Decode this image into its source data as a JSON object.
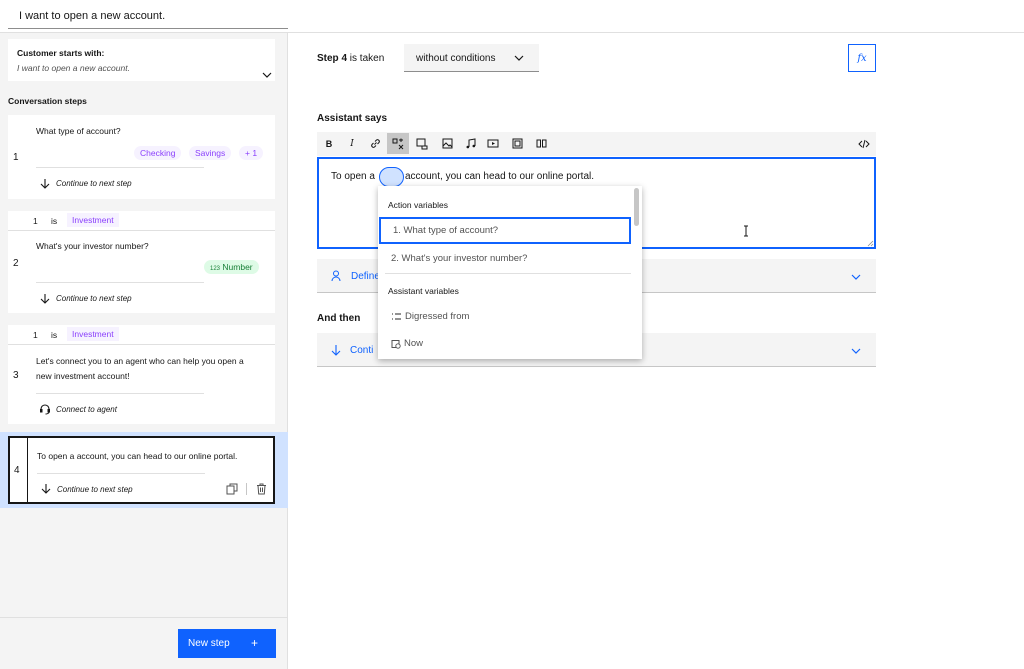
{
  "header": {
    "action_title": "I want to open a new account."
  },
  "left": {
    "customer_starts_label": "Customer starts with:",
    "customer_starts_value": "I want to open a new account.",
    "conversation_steps_label": "Conversation steps",
    "steps": [
      {
        "number": "1",
        "question": "What type of account?",
        "options": [
          "Checking",
          "Savings",
          "+ 1"
        ],
        "next": "Continue to next step"
      },
      {
        "number": "2",
        "cond_var": "1",
        "cond_op": "is",
        "cond_val": "Investment",
        "question": "What's your investor number?",
        "response_type": "Number",
        "response_icon": "123",
        "next": "Continue to next step"
      },
      {
        "number": "3",
        "cond_var": "1",
        "cond_op": "is",
        "cond_val": "Investment",
        "question_line1": "Let's connect you to an agent who can help you open a",
        "question_line2": "new investment account!",
        "next": "Connect to agent"
      },
      {
        "number": "4",
        "question": "To open a account, you can head to our online portal.",
        "next": "Continue to next step"
      }
    ],
    "new_step_label": "New step",
    "new_step_plus": "+"
  },
  "main": {
    "step_label": "Step 4",
    "step_taken": "is taken",
    "condition_select": "without conditions",
    "fx_label": "fx",
    "assistant_says": "Assistant says",
    "toolbar": [
      "B",
      "I"
    ],
    "editor_text_before": "To open a",
    "editor_text_after": "account, you can head to our online portal.",
    "define_label": "Define",
    "and_then": "And then",
    "continue_label": "Conti"
  },
  "dropdown": {
    "action_variables": "Action variables",
    "action_items": [
      "1. What type of account?",
      "2. What's your investor number?"
    ],
    "assistant_variables": "Assistant variables",
    "assistant_items": [
      "Digressed from",
      "Now"
    ]
  },
  "colors": {
    "accent": "#0f62fe",
    "purple": "#8a3ffc",
    "green": "#198038",
    "selected_bg": "#d0e2ff"
  }
}
